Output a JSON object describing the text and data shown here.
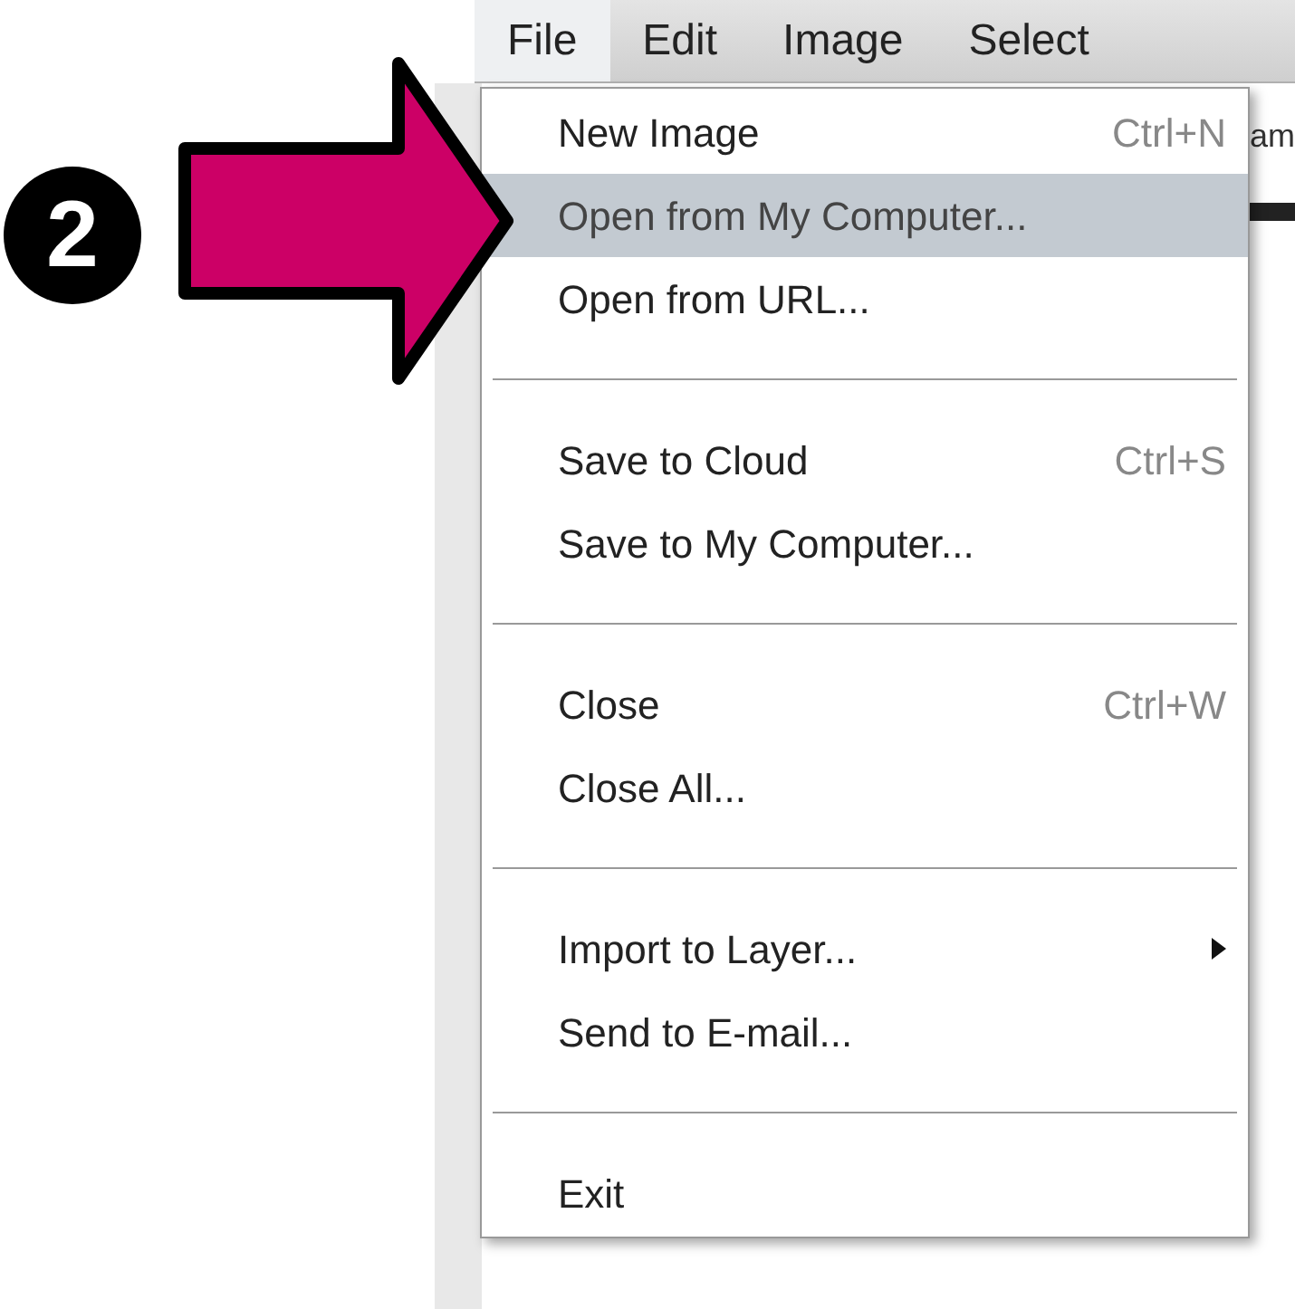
{
  "badge": "2",
  "menubar": [
    {
      "label": "File",
      "selected": true
    },
    {
      "label": "Edit",
      "selected": false
    },
    {
      "label": "Image",
      "selected": false
    },
    {
      "label": "Select",
      "selected": false
    }
  ],
  "background_text": "am",
  "menu": {
    "groups": [
      [
        {
          "label": "New Image",
          "shortcut": "Ctrl+N",
          "selected": false,
          "submenu": false
        },
        {
          "label": "Open from My Computer...",
          "selected": true,
          "submenu": false
        },
        {
          "label": "Open from URL...",
          "selected": false,
          "submenu": false
        }
      ],
      [
        {
          "label": "Save to Cloud",
          "shortcut": "Ctrl+S",
          "selected": false,
          "submenu": false
        },
        {
          "label": "Save to My Computer...",
          "selected": false,
          "submenu": false
        }
      ],
      [
        {
          "label": "Close",
          "shortcut": "Ctrl+W",
          "selected": false,
          "submenu": false
        },
        {
          "label": "Close All...",
          "selected": false,
          "submenu": false
        }
      ],
      [
        {
          "label": "Import to Layer...",
          "selected": false,
          "submenu": true
        },
        {
          "label": "Send to E-mail...",
          "selected": false,
          "submenu": false
        }
      ],
      [
        {
          "label": "Exit",
          "selected": false,
          "submenu": false
        }
      ]
    ]
  }
}
